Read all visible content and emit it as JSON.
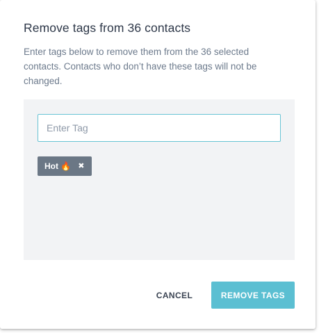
{
  "dialog": {
    "title": "Remove tags from 36 contacts",
    "description": "Enter tags below to remove them from the 36 selected contacts. Contacts who don’t have these tags will not be changed."
  },
  "tag_input": {
    "value": "",
    "placeholder": "Enter Tag"
  },
  "tags": [
    {
      "label": "Hot 🔥",
      "remove_glyph": "✖"
    }
  ],
  "actions": {
    "cancel_label": "CANCEL",
    "submit_label": "REMOVE TAGS"
  },
  "colors": {
    "primary_button": "#5bbfd2",
    "input_focus_border": "#68c3d4",
    "chip_background": "#6b7785",
    "panel_background": "#f2f3f5"
  },
  "icons": {
    "chip_remove": "close-icon",
    "chip_emoji": "fire-emoji"
  }
}
